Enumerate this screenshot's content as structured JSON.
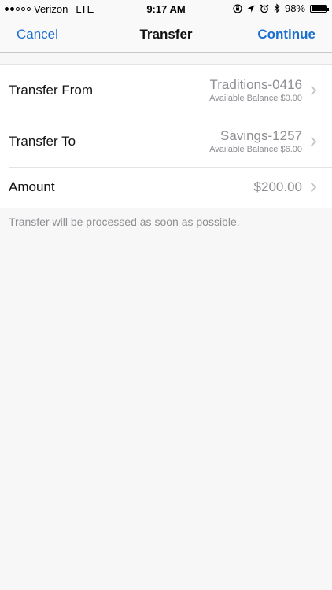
{
  "status_bar": {
    "carrier": "Verizon",
    "network": "LTE",
    "time": "9:17 AM",
    "battery": "98%",
    "signal_filled": 2,
    "signal_total": 5
  },
  "nav": {
    "cancel_label": "Cancel",
    "title": "Transfer",
    "continue_label": "Continue",
    "accent_color": "#1a6fd1"
  },
  "rows": [
    {
      "label": "Transfer From",
      "value": "Traditions-0416",
      "sub": "Available Balance $0.00"
    },
    {
      "label": "Transfer To",
      "value": "Savings-1257",
      "sub": "Available Balance $6.00"
    },
    {
      "label": "Amount",
      "value": "$200.00"
    }
  ],
  "note": "Transfer will be processed as soon as possible.",
  "icons": [
    "orientation-lock-icon",
    "location-icon",
    "alarm-icon",
    "bluetooth-icon",
    "battery-icon",
    "chevron-right-icon"
  ]
}
